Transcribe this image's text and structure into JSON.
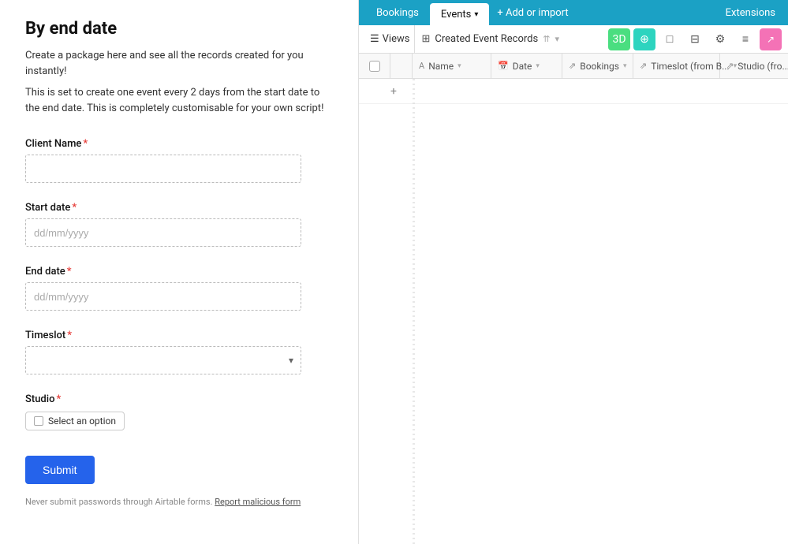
{
  "left": {
    "title": "By end date",
    "desc1": "Create a package here and see all the records created for you instantly!",
    "desc2": "This is set to create one event every 2 days from the start date to the end date. This is completely customisable for your own script!",
    "form": {
      "client_name_label": "Client Name",
      "client_name_placeholder": "",
      "start_date_label": "Start date",
      "start_date_placeholder": "dd/mm/yyyy",
      "end_date_label": "End date",
      "end_date_placeholder": "dd/mm/yyyy",
      "timeslot_label": "Timeslot",
      "studio_label": "Studio",
      "studio_option": "Select an option",
      "submit_label": "Submit",
      "footer_text": "Never submit passwords through Airtable forms.",
      "footer_link": "Report malicious form",
      "required": "*"
    }
  },
  "right": {
    "tabs": {
      "bookings": "Bookings",
      "events": "Events",
      "add_import": "+ Add or import",
      "extensions": "Extensions"
    },
    "toolbar": {
      "views": "Views",
      "view_name": "Created Event Records",
      "share_icon": "⚙"
    },
    "columns": {
      "name": "Name",
      "date": "Date",
      "bookings": "Bookings",
      "timeslot": "Timeslot (from B...",
      "studio": "Studio (fro..."
    }
  }
}
